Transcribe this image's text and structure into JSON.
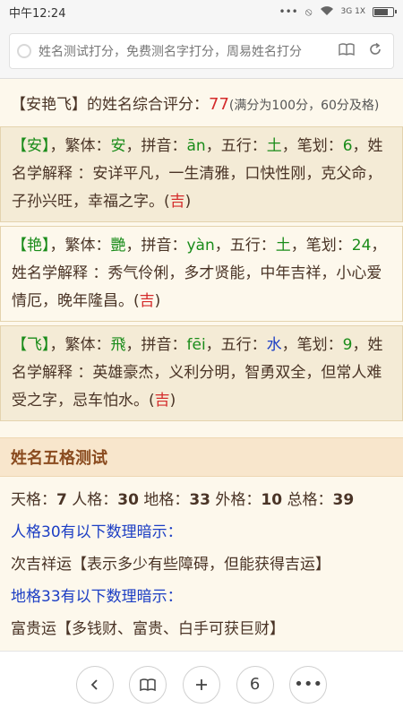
{
  "status": {
    "time": "中午12:24",
    "net": "3G 1X"
  },
  "url": {
    "title": "姓名测试打分，免费测名字打分，周易姓名打分"
  },
  "summary": {
    "name": "【安艳飞】",
    "text": "的姓名综合评分：",
    "score": "77",
    "note": "(满分为100分，60分及格)"
  },
  "chars": [
    {
      "char": "【安】",
      "label_fanti": "，繁体：",
      "fanti": "安",
      "label_pinyin": "，拼音：",
      "pinyin": "ān",
      "label_wuxing": "，五行：",
      "wuxing": "土",
      "label_bihua": "，笔划：",
      "bihua": "6",
      "explain": "，姓名学解释 ：安详平凡，一生清雅，口快性刚，克父命，子孙兴旺，幸福之字。",
      "ji_open": "(",
      "ji": "吉",
      "ji_close": ")"
    },
    {
      "char": "【艳】",
      "label_fanti": "，繁体：",
      "fanti": "艷",
      "label_pinyin": "，拼音：",
      "pinyin": "yàn",
      "label_wuxing": "，五行：",
      "wuxing": "土",
      "label_bihua": "，笔划：",
      "bihua": "24",
      "explain": "，姓名学解释 ：秀气伶俐，多才贤能，中年吉祥，小心爱情厄，晚年隆昌。",
      "ji_open": "(",
      "ji": "吉",
      "ji_close": ")"
    },
    {
      "char": "【飞】",
      "label_fanti": "，繁体：",
      "fanti": "飛",
      "label_pinyin": "，拼音：",
      "pinyin": "fēi",
      "label_wuxing": "，五行：",
      "wuxing": "水",
      "label_bihua": "，笔划：",
      "bihua": "9",
      "explain": "，姓名学解释 ：英雄豪杰，义利分明，智勇双全，但常人难受之字，忌车怕水。",
      "ji_open": "(",
      "ji": "吉",
      "ji_close": ")"
    }
  ],
  "wuge": {
    "title": "姓名五格测试",
    "tian_label": "天格：",
    "tian": "7",
    "ren_label": "人格：",
    "ren": "30",
    "di_label": "地格：",
    "di": "33",
    "wai_label": "外格：",
    "wai": "10",
    "zong_label": "总格：",
    "zong": "39",
    "ren_hint": "人格30有以下数理暗示：",
    "ren_text": "次吉祥运【表示多少有些障碍，但能获得吉运】",
    "di_hint": "地格33有以下数理暗示：",
    "di_text": "富贵运【多钱财、富贵、白手可获巨财】"
  },
  "bottom": {
    "tabs_count": "6"
  }
}
